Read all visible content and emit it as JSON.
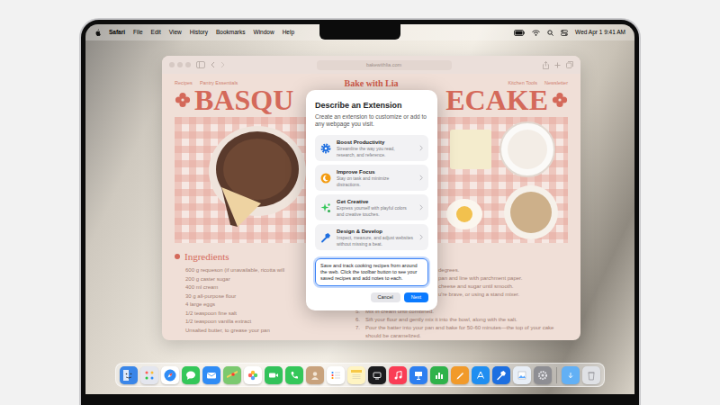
{
  "menu_bar": {
    "items": [
      {
        "label": "Safari",
        "kind": "app"
      },
      {
        "label": "File",
        "kind": "menu"
      },
      {
        "label": "Edit",
        "kind": "menu"
      },
      {
        "label": "View",
        "kind": "menu"
      },
      {
        "label": "History",
        "kind": "menu"
      },
      {
        "label": "Bookmarks",
        "kind": "menu"
      },
      {
        "label": "Window",
        "kind": "menu"
      },
      {
        "label": "Help",
        "kind": "menu"
      }
    ],
    "clock": "Wed Apr 1 9:41 AM"
  },
  "safari": {
    "address": "bakewithlia.com"
  },
  "page": {
    "nav_left": [
      "Recipes",
      "Pantry Essentials"
    ],
    "title": "Bake with Lia",
    "nav_right": [
      "Kitchen Tools",
      "Newsletter"
    ],
    "heading_left": "BASQU",
    "heading_right": "ECAKE",
    "ingredients_title": "Ingredients",
    "ingredients": [
      "600 g requeson (if unavailable, ricotta will",
      "200 g caster sugar",
      "400 ml cream",
      "30 g all-purpose flour",
      "4 large eggs",
      "1/2 teaspoon fine salt",
      "1/2 teaspoon vanilla extract",
      "Unsalted butter, to grease your pan"
    ],
    "step_fragments": [
      "degrees.",
      "pan and line with parchment paper.",
      "cheese and sugar until smooth.",
      "u're brave, or using a stand mixer."
    ],
    "steps": [
      {
        "number": "5.",
        "text": "Mix in cream until combined."
      },
      {
        "number": "6.",
        "text": "Sift your flour and gently mix it into the bowl, along with the salt."
      },
      {
        "number": "7.",
        "text": "Pour the batter into your pan and bake for 50-60 minutes—the top of your cake should be caramelized."
      }
    ]
  },
  "dialog": {
    "title": "Describe an Extension",
    "subtitle": "Create an extension to customize or add to any webpage you visit.",
    "options": [
      {
        "title": "Boost Productivity",
        "description": "Streamline the way you read, research, and reference."
      },
      {
        "title": "Improve Focus",
        "description": "Stay on task and minimize distractions."
      },
      {
        "title": "Get Creative",
        "description": "Express yourself with playful colors and creative touches."
      },
      {
        "title": "Design & Develop",
        "description": "Inspect, measure, and adjust websites without missing a beat."
      }
    ],
    "prompt": {
      "text": "Save and track cooking recipes from around the web. Click the toolbar button to see your saved recipes and add notes to each.",
      "focused": true
    },
    "buttons": [
      {
        "label": "Cancel",
        "primary": false
      },
      {
        "label": "Next",
        "primary": true
      }
    ]
  }
}
